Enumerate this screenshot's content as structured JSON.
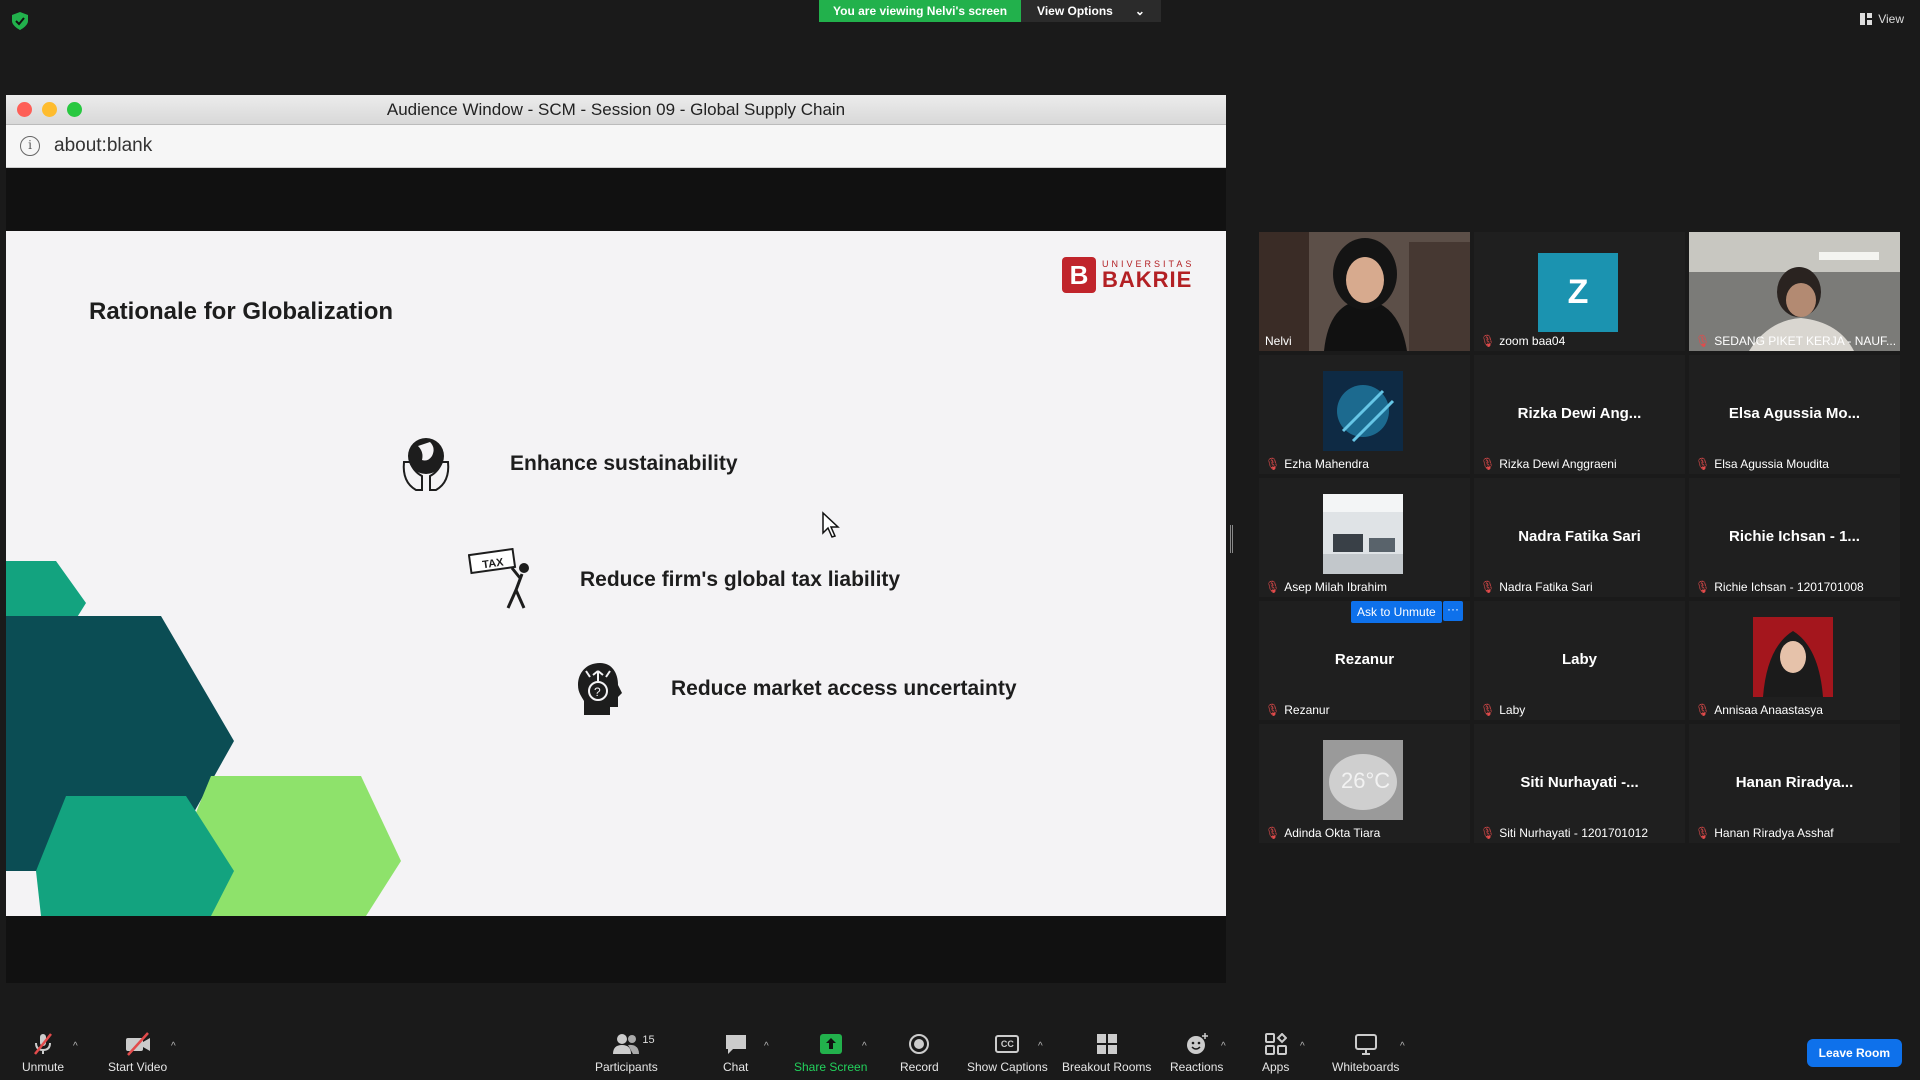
{
  "top": {
    "viewing_banner": "You are viewing Nelvi's screen",
    "view_options": "View Options",
    "view_button": "View"
  },
  "shared_window": {
    "title": "Audience Window - SCM - Session 09 - Global Supply Chain",
    "url": "about:blank"
  },
  "slide": {
    "title": "Rationale for Globalization",
    "logo_small": "UNIVERSITAS",
    "logo_big": "BAKRIE",
    "bullets": [
      "Enhance sustainability",
      "Reduce firm's global tax liability",
      "Reduce market access uncertainty"
    ],
    "tax_sign": "TAX"
  },
  "gallery": {
    "z_letter": "Z",
    "ask_unmute": "Ask to Unmute",
    "more": "···",
    "tiles": [
      {
        "name": "Nelvi",
        "center": ""
      },
      {
        "name": "zoom baa04",
        "center": ""
      },
      {
        "name": "SEDANG PIKET KERJA - NAUF...",
        "center": ""
      },
      {
        "name": "Ezha Mahendra",
        "center": ""
      },
      {
        "name": "Rizka Dewi Anggraeni",
        "center": "Rizka Dewi Ang..."
      },
      {
        "name": "Elsa Agussia Moudita",
        "center": "Elsa Agussia Mo..."
      },
      {
        "name": "Asep Milah Ibrahim",
        "center": ""
      },
      {
        "name": "Nadra Fatika Sari",
        "center": "Nadra Fatika Sari"
      },
      {
        "name": "Richie Ichsan - 1201701008",
        "center": "Richie Ichsan - 1..."
      },
      {
        "name": "Rezanur",
        "center": "Rezanur"
      },
      {
        "name": "Laby",
        "center": "Laby"
      },
      {
        "name": "Annisaa Anaastasya",
        "center": ""
      },
      {
        "name": "Adinda Okta Tiara",
        "center": ""
      },
      {
        "name": "Siti Nurhayati - 1201701012",
        "center": "Siti Nurhayati -..."
      },
      {
        "name": "Hanan Riradya Asshaf",
        "center": "Hanan Riradya..."
      }
    ],
    "thumb_text": "26°C"
  },
  "toolbar": {
    "unmute": "Unmute",
    "start_video": "Start Video",
    "participants": "Participants",
    "participants_count": "15",
    "chat": "Chat",
    "share_screen": "Share Screen",
    "record": "Record",
    "show_captions": "Show Captions",
    "breakout_rooms": "Breakout Rooms",
    "reactions": "Reactions",
    "apps": "Apps",
    "whiteboards": "Whiteboards",
    "leave_room": "Leave Room",
    "cc": "CC"
  },
  "colors": {
    "share_green": "#22b14c",
    "active_speaker": "#c9ec5b",
    "zoom_blue": "#0e71eb",
    "muted_red": "#e24b4b",
    "bakrie_red": "#c0242b",
    "hex_dark": "#0b4d54",
    "hex_teal": "#13a37f",
    "hex_light": "#8ee26b"
  }
}
